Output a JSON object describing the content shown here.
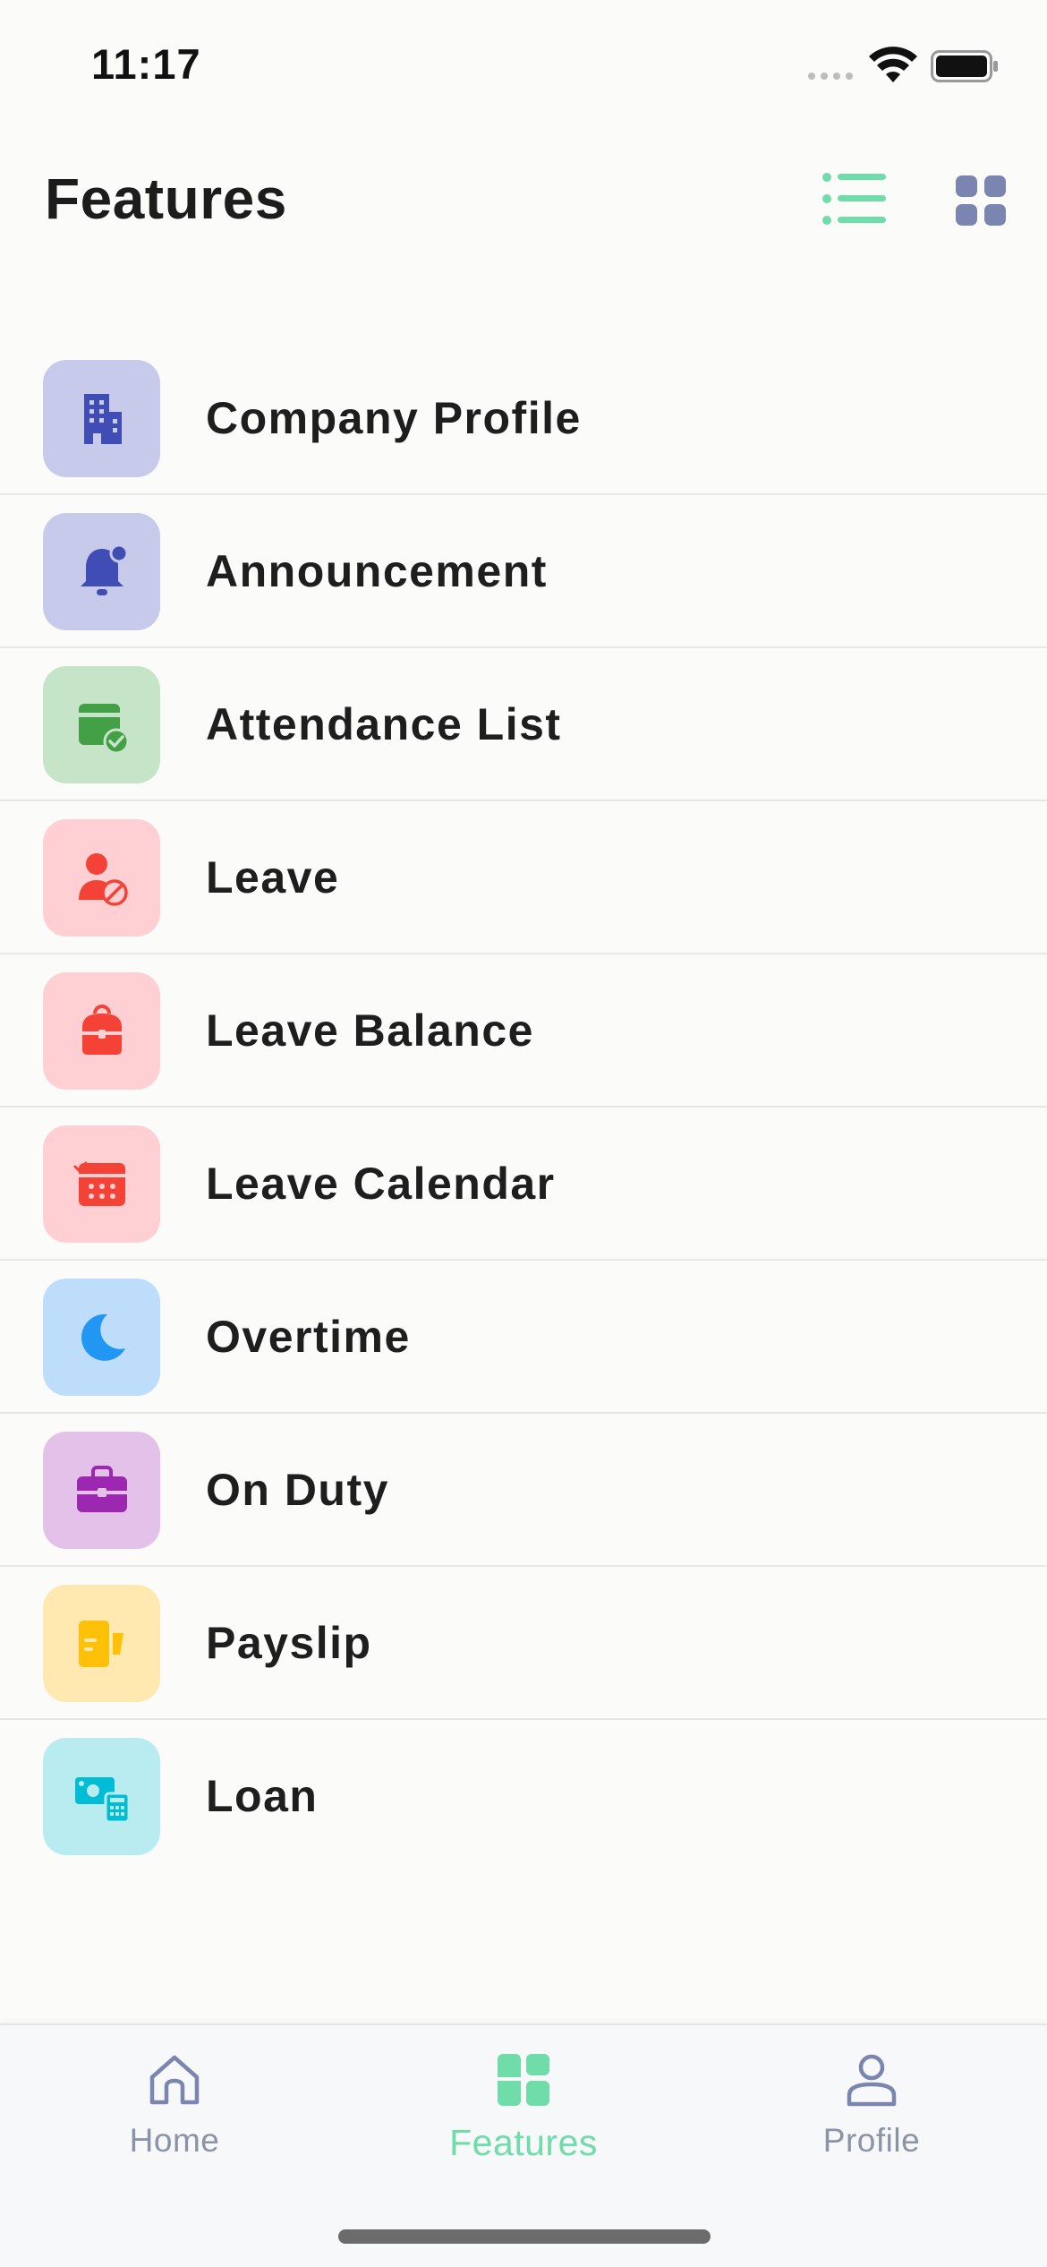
{
  "status_bar": {
    "time": "11:17"
  },
  "header": {
    "title": "Features"
  },
  "features": [
    {
      "label": "Company Profile",
      "icon": "building-icon",
      "bg": "#C8CAEB",
      "fg": "#3F4DB5"
    },
    {
      "label": "Announcement",
      "icon": "bell-icon",
      "bg": "#C8CAEB",
      "fg": "#3F4DB5"
    },
    {
      "label": "Attendance List",
      "icon": "calendar-check-icon",
      "bg": "#C6E5C8",
      "fg": "#43A047"
    },
    {
      "label": "Leave",
      "icon": "user-blocked-icon",
      "bg": "#FFD0D3",
      "fg": "#F44336"
    },
    {
      "label": "Leave Balance",
      "icon": "backpack-icon",
      "bg": "#FFD0D3",
      "fg": "#F44336"
    },
    {
      "label": "Leave Calendar",
      "icon": "calendar-icon",
      "bg": "#FFD0D3",
      "fg": "#F44336"
    },
    {
      "label": "Overtime",
      "icon": "moon-icon",
      "bg": "#BEDDFB",
      "fg": "#2196F3"
    },
    {
      "label": "On Duty",
      "icon": "briefcase-icon",
      "bg": "#E3C1E8",
      "fg": "#9C27B0"
    },
    {
      "label": "Payslip",
      "icon": "payslip-icon",
      "bg": "#FFE9B0",
      "fg": "#FFC107"
    },
    {
      "label": "Loan",
      "icon": "money-calculator-icon",
      "bg": "#B9ECF1",
      "fg": "#00BCD4"
    }
  ],
  "bottom_nav": {
    "items": [
      {
        "label": "Home",
        "icon": "home-icon",
        "active": false
      },
      {
        "label": "Features",
        "icon": "features-icon",
        "active": true
      },
      {
        "label": "Profile",
        "icon": "profile-icon",
        "active": false
      }
    ]
  },
  "colors": {
    "accent": "#6FDCA9",
    "inactive": "#8A94A6",
    "grid_icon": "#7B86B0"
  }
}
